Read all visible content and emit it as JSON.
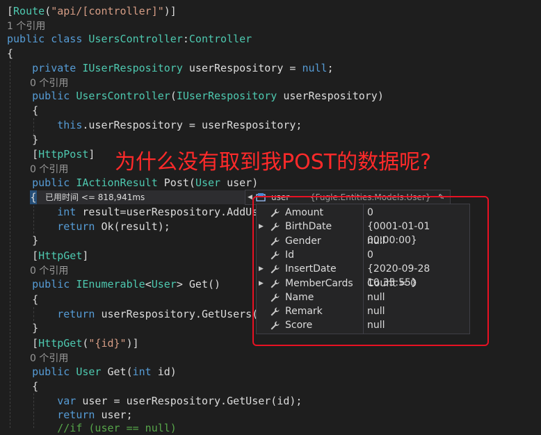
{
  "code": {
    "lines": [
      {
        "segments": [
          {
            "t": "[",
            "c": "tx"
          },
          {
            "t": "Route",
            "c": "at"
          },
          {
            "t": "(",
            "c": "tx"
          },
          {
            "t": "\"api/[controller]\"",
            "c": "st"
          },
          {
            "t": ")]",
            "c": "tx"
          }
        ]
      },
      {
        "ref": "1 个引用"
      },
      {
        "segments": [
          {
            "t": "public ",
            "c": "kw"
          },
          {
            "t": "class ",
            "c": "kw"
          },
          {
            "t": "UsersController",
            "c": "ty"
          },
          {
            "t": ":",
            "c": "tx"
          },
          {
            "t": "Controller",
            "c": "ty"
          }
        ]
      },
      {
        "segments": [
          {
            "t": "{",
            "c": "tx"
          }
        ]
      },
      {
        "segments": [
          {
            "t": "    private ",
            "c": "kw"
          },
          {
            "t": "IUserRespository ",
            "c": "ty"
          },
          {
            "t": "userRespository ",
            "c": "tx"
          },
          {
            "t": "= ",
            "c": "tx"
          },
          {
            "t": "null",
            "c": "kw"
          },
          {
            "t": ";",
            "c": "tx"
          }
        ]
      },
      {
        "ref": "0 个引用"
      },
      {
        "segments": [
          {
            "t": "    public ",
            "c": "kw"
          },
          {
            "t": "UsersController",
            "c": "ty"
          },
          {
            "t": "(",
            "c": "tx"
          },
          {
            "t": "IUserRespository ",
            "c": "ty"
          },
          {
            "t": "userRespository)",
            "c": "tx"
          }
        ]
      },
      {
        "segments": [
          {
            "t": "    {",
            "c": "tx"
          }
        ]
      },
      {
        "segments": [
          {
            "t": "        this",
            "c": "kw"
          },
          {
            "t": ".userRespository = userRespository;",
            "c": "tx"
          }
        ]
      },
      {
        "segments": [
          {
            "t": "    }",
            "c": "tx"
          }
        ]
      },
      {
        "segments": [
          {
            "t": "    [",
            "c": "tx"
          },
          {
            "t": "HttpPost",
            "c": "at"
          },
          {
            "t": "]",
            "c": "tx"
          }
        ]
      },
      {
        "ref": "0 个引用"
      },
      {
        "segments": [
          {
            "t": "    public ",
            "c": "kw"
          },
          {
            "t": "IActionResult ",
            "c": "ty"
          },
          {
            "t": "Post(",
            "c": "tx"
          },
          {
            "t": "User ",
            "c": "ty"
          },
          {
            "t": "user)",
            "c": "tx"
          }
        ]
      },
      {
        "segments": []
      },
      {
        "segments": [
          {
            "t": "        int ",
            "c": "kw"
          },
          {
            "t": "result=userRespository.AddUse",
            "c": "tx"
          }
        ]
      },
      {
        "segments": [
          {
            "t": "        return ",
            "c": "kw"
          },
          {
            "t": "Ok(result);",
            "c": "tx"
          }
        ]
      },
      {
        "segments": [
          {
            "t": "    }",
            "c": "tx"
          }
        ]
      },
      {
        "segments": [
          {
            "t": "    [",
            "c": "tx"
          },
          {
            "t": "HttpGet",
            "c": "at"
          },
          {
            "t": "]",
            "c": "tx"
          }
        ]
      },
      {
        "ref": "0 个引用"
      },
      {
        "segments": [
          {
            "t": "    public ",
            "c": "kw"
          },
          {
            "t": "IEnumerable",
            "c": "ty"
          },
          {
            "t": "<",
            "c": "tx"
          },
          {
            "t": "User",
            "c": "ty"
          },
          {
            "t": "> Get()",
            "c": "tx"
          }
        ]
      },
      {
        "segments": [
          {
            "t": "    {",
            "c": "tx"
          }
        ]
      },
      {
        "segments": [
          {
            "t": "        return ",
            "c": "kw"
          },
          {
            "t": "userRespository.GetUsers()",
            "c": "tx"
          }
        ]
      },
      {
        "segments": [
          {
            "t": "    }",
            "c": "tx"
          }
        ]
      },
      {
        "segments": [
          {
            "t": "    [",
            "c": "tx"
          },
          {
            "t": "HttpGet",
            "c": "at"
          },
          {
            "t": "(",
            "c": "tx"
          },
          {
            "t": "\"{id}\"",
            "c": "st"
          },
          {
            "t": ")]",
            "c": "tx"
          }
        ]
      },
      {
        "ref": "0 个引用"
      },
      {
        "segments": [
          {
            "t": "    public ",
            "c": "kw"
          },
          {
            "t": "User ",
            "c": "ty"
          },
          {
            "t": "Get(",
            "c": "tx"
          },
          {
            "t": "int ",
            "c": "kw"
          },
          {
            "t": "id)",
            "c": "tx"
          }
        ]
      },
      {
        "segments": [
          {
            "t": "    {",
            "c": "tx"
          }
        ]
      },
      {
        "segments": [
          {
            "t": "        var ",
            "c": "kw"
          },
          {
            "t": "user = userRespository.GetUser(id);",
            "c": "tx"
          }
        ]
      },
      {
        "segments": [
          {
            "t": "        return ",
            "c": "kw"
          },
          {
            "t": "user;",
            "c": "tx"
          }
        ]
      },
      {
        "segments": [
          {
            "t": "        //if (user == null)",
            "c": "cm"
          }
        ]
      }
    ]
  },
  "codelens": {
    "brace": "{",
    "perf_tip": "已用时间 <= 818,941ms"
  },
  "annotation": {
    "text": "为什么没有取到我POST的数据呢?"
  },
  "datatip": {
    "variable": "user",
    "type_value": "{Fugle.Entities.Models.User}",
    "properties": [
      {
        "name": "Amount",
        "value": "0",
        "expandable": false
      },
      {
        "name": "BirthDate",
        "value": "{0001-01-01 00:00:00}",
        "expandable": true
      },
      {
        "name": "Gender",
        "value": "null",
        "expandable": false
      },
      {
        "name": "Id",
        "value": "0",
        "expandable": false
      },
      {
        "name": "InsertDate",
        "value": "{2020-09-28 10:35:55}",
        "expandable": true
      },
      {
        "name": "MemberCards",
        "value": "Count = 0",
        "expandable": true
      },
      {
        "name": "Name",
        "value": "null",
        "expandable": false
      },
      {
        "name": "Remark",
        "value": "null",
        "expandable": false
      },
      {
        "name": "Score",
        "value": "null",
        "expandable": false
      }
    ]
  },
  "colors": {
    "editor_bg": "#1e1e1e",
    "keyword": "#569cd6",
    "type": "#4ec9b0",
    "string": "#d69d85",
    "annotation_red": "#ff2a2a",
    "highlight_box": "#e81123"
  }
}
